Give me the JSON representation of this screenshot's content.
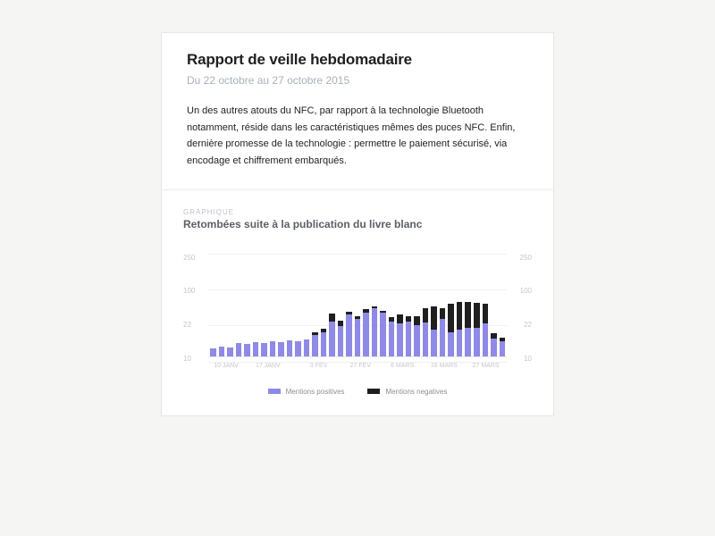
{
  "report": {
    "title": "Rapport de veille hebdomadaire",
    "date_range": "Du 22 octobre au 27 octobre 2015",
    "body": "Un des autres atouts du NFC, par rapport à la technologie Bluetooth notamment, réside dans les caractéristiques mêmes des puces NFC. Enfin, dernière promesse de la technologie : permettre le paiement sécurisé, via encodage et chiffrement embarqués."
  },
  "chart": {
    "overline": "GRAPHIQUE",
    "title": "Retombées suite à la publication du livre blanc"
  },
  "legend": {
    "positive": "Mentions positives",
    "negative": "Mentions negatives"
  },
  "y_ticks": [
    "250",
    "100",
    "22",
    "10"
  ],
  "x_ticks": [
    {
      "label": "10 JANV",
      "pct": "6%"
    },
    {
      "label": "17 JANV",
      "pct": "20%"
    },
    {
      "label": "3 FEV",
      "pct": "37%"
    },
    {
      "label": "27 FEV",
      "pct": "51%"
    },
    {
      "label": "6 MARS",
      "pct": "65%"
    },
    {
      "label": "16 MARS",
      "pct": "79%"
    },
    {
      "label": "27 MARS",
      "pct": "93%"
    }
  ],
  "colors": {
    "positive": "#8f8ae6",
    "negative": "#1f1f1f"
  },
  "chart_data": {
    "type": "bar",
    "title": "Retombées suite à la publication du livre blanc",
    "xlabel": "",
    "ylabel": "",
    "ylim": [
      0,
      250
    ],
    "y_ticks": [
      10,
      22,
      100,
      250
    ],
    "x_tick_labels": [
      "10 JANV",
      "17 JANV",
      "3 FEV",
      "27 FEV",
      "6 MARS",
      "16 MARS",
      "27 MARS"
    ],
    "categories": [
      1,
      2,
      3,
      4,
      5,
      6,
      7,
      8,
      9,
      10,
      11,
      12,
      13,
      14,
      15,
      16,
      17,
      18,
      19,
      20,
      21,
      22,
      23,
      24,
      25,
      26,
      27,
      28,
      29,
      30,
      31,
      32,
      33,
      34,
      35
    ],
    "series": [
      {
        "name": "Mentions positives",
        "values": [
          18,
          22,
          20,
          30,
          28,
          32,
          30,
          34,
          32,
          36,
          34,
          38,
          48,
          55,
          80,
          70,
          95,
          85,
          100,
          110,
          100,
          80,
          75,
          80,
          72,
          78,
          60,
          85,
          55,
          60,
          65,
          65,
          75,
          40,
          35
        ]
      },
      {
        "name": "Mentions negatives",
        "values": [
          0,
          0,
          0,
          0,
          0,
          0,
          0,
          0,
          0,
          0,
          0,
          0,
          6,
          8,
          18,
          12,
          8,
          6,
          8,
          5,
          5,
          10,
          20,
          12,
          20,
          32,
          55,
          25,
          65,
          65,
          60,
          58,
          45,
          12,
          8
        ]
      }
    ]
  }
}
